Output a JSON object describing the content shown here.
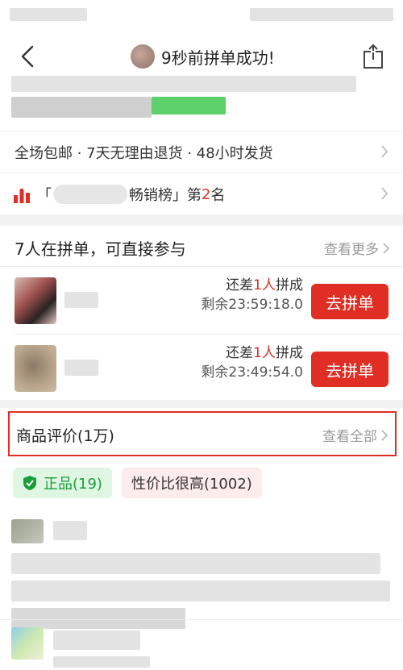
{
  "nav": {
    "title": "9秒前拼单成功!"
  },
  "services": {
    "text": "全场包邮 · 7天无理由退货 · 48小时发货"
  },
  "ranking": {
    "open_bracket": "「",
    "suffix": "畅销榜」第",
    "rank": "2",
    "rank_unit": "名"
  },
  "group_buy": {
    "title": "7人在拼单，可直接参与",
    "more_label": "查看更多",
    "rows": [
      {
        "need_prefix": "还差",
        "need_count": "1人",
        "need_suffix": "拼成",
        "timer": "剩余23:59:18.0",
        "button": "去拼单"
      },
      {
        "need_prefix": "还差",
        "need_count": "1人",
        "need_suffix": "拼成",
        "timer": "剩余23:49:54.0",
        "button": "去拼单"
      }
    ]
  },
  "reviews": {
    "title": "商品评价(1万)",
    "all_label": "查看全部",
    "tags": [
      {
        "label": "正品(19)",
        "icon": "shield-check-icon"
      },
      {
        "label": "性价比很高(1002)"
      }
    ]
  },
  "colors": {
    "accent_red": "#e02e24",
    "tag_green_text": "#1a9e3a",
    "tag_green_bg": "#dff6e3",
    "tag_pink_bg": "#fdeceb"
  }
}
